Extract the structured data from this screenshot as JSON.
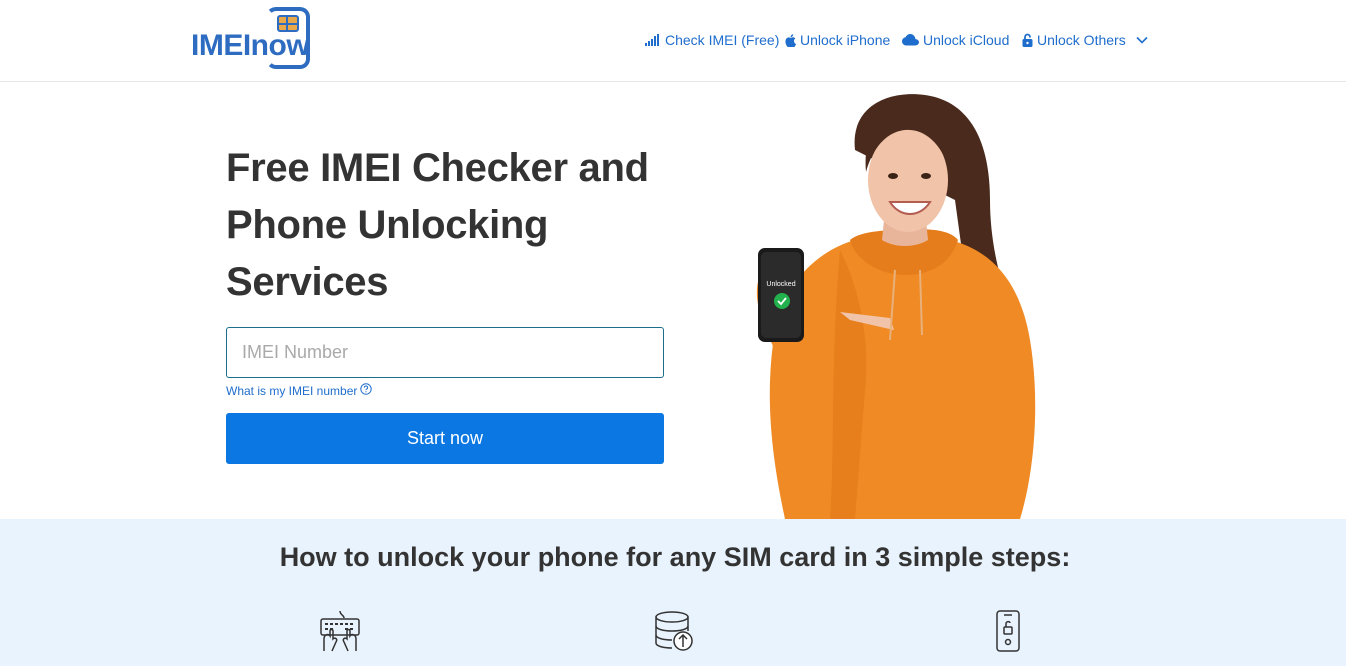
{
  "header": {
    "logo_text": "IMEInow",
    "nav": [
      {
        "label": "Check IMEI (Free)",
        "icon": "signal-bars-icon"
      },
      {
        "label": "Unlock iPhone",
        "icon": "apple-icon"
      },
      {
        "label": "Unlock iCloud",
        "icon": "cloud-icon"
      },
      {
        "label": "Unlock Others",
        "icon": "unlock-icon",
        "dropdown": true
      }
    ]
  },
  "hero": {
    "title": "Free IMEI Checker and Phone Unlocking Services",
    "input_placeholder": "IMEI Number",
    "help_link": "What is my IMEI number",
    "cta_label": "Start now",
    "phone_screen_text": "Unlocked"
  },
  "steps": {
    "title": "How to unlock your phone for any SIM card in 3 simple steps:",
    "icons": [
      "keyboard-typing-icon",
      "database-upload-icon",
      "phone-unlock-icon"
    ]
  },
  "colors": {
    "brand": "#2d6cc0",
    "link": "#1f6dcc",
    "button": "#0a77e2",
    "band": "#e9f3fd",
    "hoodie": "#f08a24"
  }
}
